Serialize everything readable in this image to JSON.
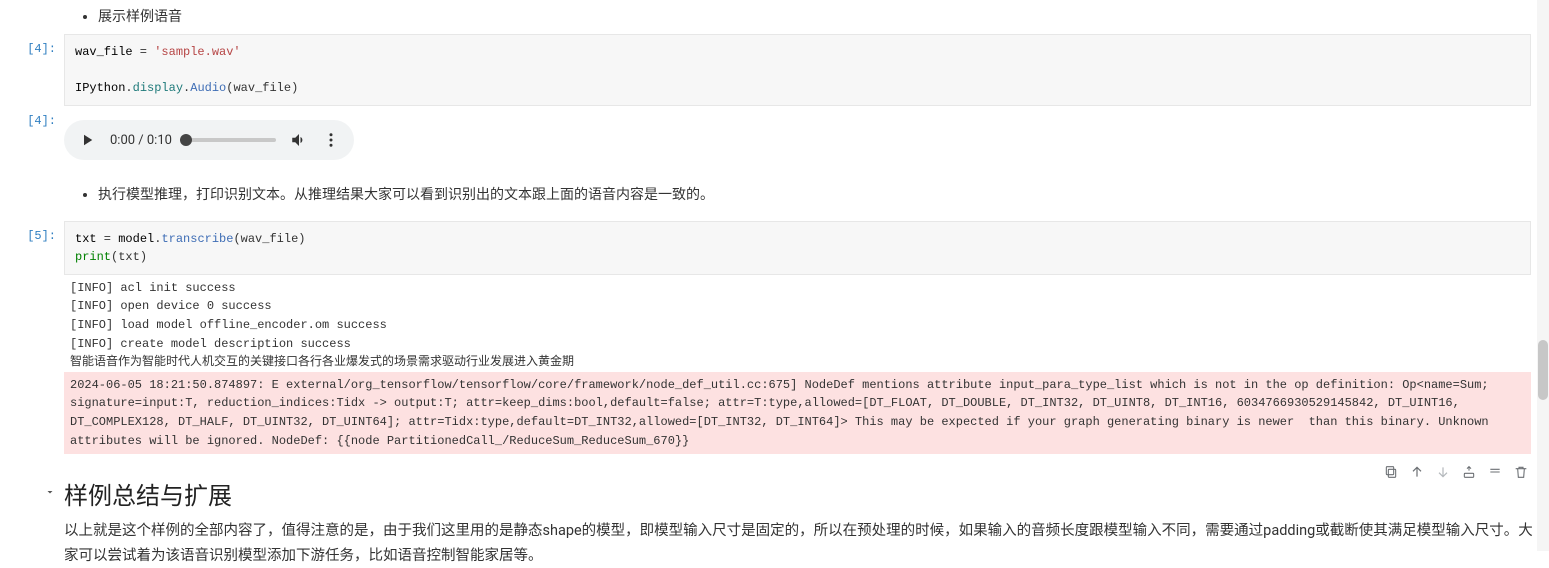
{
  "cells": {
    "partial_bullet": "展示样例语音",
    "run_bullet": "执行模型推理，打印识别文本。从推理结果大家可以看到识别出的文本跟上面的语音内容是一致的。"
  },
  "prompts": {
    "cell4_in": "[4]:",
    "cell4_out": "[4]:",
    "cell5_in": "[5]:"
  },
  "code4": {
    "l1_var": "wav_file",
    "l1_eq": " = ",
    "l1_str": "'sample.wav'",
    "blank": "",
    "l2_a": "IPython",
    "l2_b": "display",
    "l2_c": "Audio",
    "l2_arg": "(wav_file)"
  },
  "audio": {
    "time": "0:00 / 0:10"
  },
  "code5": {
    "l1_a": "txt",
    "l1_eq": " = ",
    "l1_b": "model",
    "l1_dot": ".",
    "l1_c": "transcribe",
    "l1_d": "(wav_file)",
    "l2_a": "print",
    "l2_b": "(txt)"
  },
  "stdout5": "[INFO] acl init success\n[INFO] open device 0 success\n[INFO] load model offline_encoder.om success\n[INFO] create model description success\n智能语音作为智能时代人机交互的关键接口各行各业爆发式的场景需求驱动行业发展进入黄金期",
  "stderr5": "2024-06-05 18:21:50.874897: E external/org_tensorflow/tensorflow/core/framework/node_def_util.cc:675] NodeDef mentions attribute input_para_type_list which is not in the op definition: Op<name=Sum; signature=input:T, reduction_indices:Tidx -> output:T; attr=keep_dims:bool,default=false; attr=T:type,allowed=[DT_FLOAT, DT_DOUBLE, DT_INT32, DT_UINT8, DT_INT16, 6034766930529145842, DT_UINT16, DT_COMPLEX128, DT_HALF, DT_UINT32, DT_UINT64]; attr=Tidx:type,default=DT_INT32,allowed=[DT_INT32, DT_INT64]> This may be expected if your graph generating binary is newer  than this binary. Unknown attributes will be ignored. NodeDef: {{node PartitionedCall_/ReduceSum_ReduceSum_670}}",
  "section": {
    "heading": "样例总结与扩展",
    "body": "以上就是这个样例的全部内容了，值得注意的是，由于我们这里用的是静态shape的模型，即模型输入尺寸是固定的，所以在预处理的时候，如果输入的音频长度跟模型输入不同，需要通过padding或截断使其满足模型输入尺寸。大家可以尝试着为该语音识别模型添加下游任务，比如语音控制智能家居等。"
  },
  "toolbar_icons": [
    "copy-icon",
    "arrow-up-icon",
    "arrow-down-icon",
    "insert-above-icon",
    "insert-below-icon",
    "delete-icon"
  ]
}
